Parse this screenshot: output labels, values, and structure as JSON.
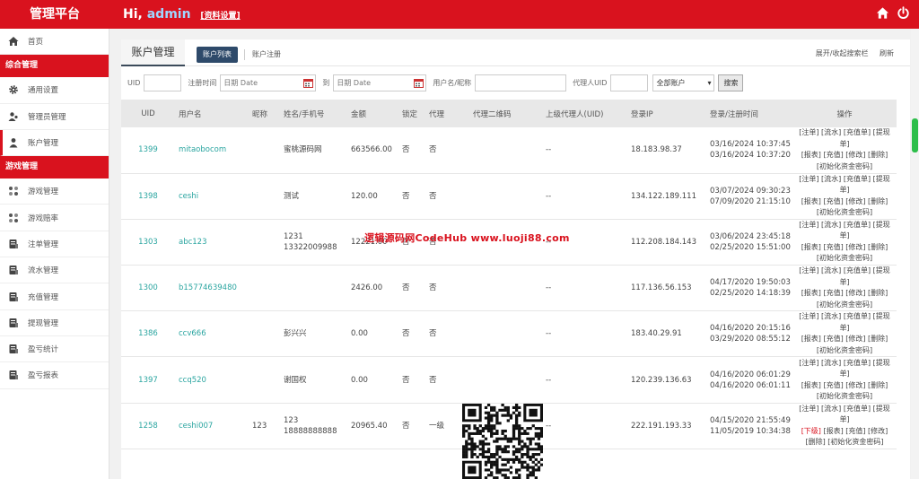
{
  "header": {
    "brand": "管理平台",
    "greeting": "Hi,",
    "user": "admin",
    "profile_link": "[资料设置]",
    "colors": {
      "header_bg": "#d9121e",
      "accent": "#2e4a6a",
      "link": "#2aa5a0"
    }
  },
  "sidebar": {
    "home": "首页",
    "group1": "综合管理",
    "group1_items": [
      "通用设置",
      "管理员管理",
      "账户管理"
    ],
    "group2": "游戏管理",
    "group2_items": [
      "游戏管理",
      "游戏赔率",
      "注单管理",
      "流水管理",
      "充值管理",
      "提现管理",
      "盈亏统计",
      "盈亏报表"
    ]
  },
  "main": {
    "page_title": "账户管理",
    "tab_active": "账户列表",
    "tab_other": "账户注册",
    "toggle_search": "展开/收起搜索栏",
    "refresh": "刷新"
  },
  "search": {
    "uid_label": "UID",
    "regtime_label": "注册时间",
    "date_placeholder": "日期 Date",
    "to_label": "到",
    "username_label": "用户名/昵称",
    "agent_uid_label": "代理人UID",
    "account_type": "全部账户",
    "search_button": "搜索"
  },
  "table": {
    "headers": [
      "UID",
      "用户名",
      "昵称",
      "姓名/手机号",
      "金额",
      "锁定",
      "代理",
      "代理二维码",
      "上级代理人(UID)",
      "登录IP",
      "登录/注册时间",
      "操作"
    ],
    "rows": [
      {
        "uid": "1399",
        "username": "mitaobocom",
        "nickname": "",
        "name": "蜜桃源码网",
        "phone": "",
        "amount": "663566.00",
        "locked": "否",
        "agent": "否",
        "parent": "--",
        "ip": "18.183.98.37",
        "login": "03/16/2024 10:37:45",
        "reg": "03/16/2024 10:37:20",
        "ops1": "[注单] [流水] [充值单] [提现单]",
        "ops2": "[报表] [充值] [修改] [删除]",
        "ops3": "[初始化资金密码]",
        "xiafen": ""
      },
      {
        "uid": "1398",
        "username": "ceshi",
        "nickname": "",
        "name": "测试",
        "phone": "",
        "amount": "120.00",
        "locked": "否",
        "agent": "否",
        "parent": "--",
        "ip": "134.122.189.111",
        "login": "03/07/2024 09:30:23",
        "reg": "07/09/2020 21:15:10",
        "ops1": "[注单] [流水] [充值单] [提现单]",
        "ops2": "[报表] [充值] [修改] [删除]",
        "ops3": "[初始化资金密码]",
        "xiafen": ""
      },
      {
        "uid": "1303",
        "username": "abc123",
        "nickname": "",
        "name": "1231",
        "phone": "13322009988",
        "amount": "12221.00",
        "locked": "否",
        "agent": "否",
        "parent": "--",
        "ip": "112.208.184.143",
        "login": "03/06/2024 23:45:18",
        "reg": "02/25/2020 15:51:00",
        "ops1": "[注单] [流水] [充值单] [提现单]",
        "ops2": "[报表] [充值] [修改] [删除]",
        "ops3": "[初始化资金密码]",
        "xiafen": ""
      },
      {
        "uid": "1300",
        "username": "b15774639480",
        "nickname": "",
        "name": "",
        "phone": "",
        "amount": "2426.00",
        "locked": "否",
        "agent": "否",
        "parent": "--",
        "ip": "117.136.56.153",
        "login": "04/17/2020 19:50:03",
        "reg": "02/25/2020 14:18:39",
        "ops1": "[注单] [流水] [充值单] [提现单]",
        "ops2": "[报表] [充值] [修改] [删除]",
        "ops3": "[初始化资金密码]",
        "xiafen": ""
      },
      {
        "uid": "1386",
        "username": "ccv666",
        "nickname": "",
        "name": "彭兴兴",
        "phone": "",
        "amount": "0.00",
        "locked": "否",
        "agent": "否",
        "parent": "--",
        "ip": "183.40.29.91",
        "login": "04/16/2020 20:15:16",
        "reg": "03/29/2020 08:55:12",
        "ops1": "[注单] [流水] [充值单] [提现单]",
        "ops2": "[报表] [充值] [修改] [删除]",
        "ops3": "[初始化资金密码]",
        "xiafen": ""
      },
      {
        "uid": "1397",
        "username": "ccq520",
        "nickname": "",
        "name": "谢国权",
        "phone": "",
        "amount": "0.00",
        "locked": "否",
        "agent": "否",
        "parent": "--",
        "ip": "120.239.136.63",
        "login": "04/16/2020 06:01:29",
        "reg": "04/16/2020 06:01:11",
        "ops1": "[注单] [流水] [充值单] [提现单]",
        "ops2": "[报表] [充值] [修改] [删除]",
        "ops3": "[初始化资金密码]",
        "xiafen": ""
      },
      {
        "uid": "1258",
        "username": "ceshi007",
        "nickname": "123",
        "name": "123",
        "phone": "18888888888",
        "amount": "20965.40",
        "locked": "否",
        "agent": "一级",
        "parent": "--",
        "ip": "222.191.193.33",
        "login": "04/15/2020 21:55:49",
        "reg": "11/05/2019 10:34:38",
        "ops1": "[注单] [流水] [充值单] [提现单]",
        "ops2": "[报表] [充值] [修改]",
        "ops3": "[删除] [初始化资金密码]",
        "xiafen": "[下级]"
      }
    ]
  },
  "watermark": "逻辑源码网CodeHub www.luoji88.com"
}
